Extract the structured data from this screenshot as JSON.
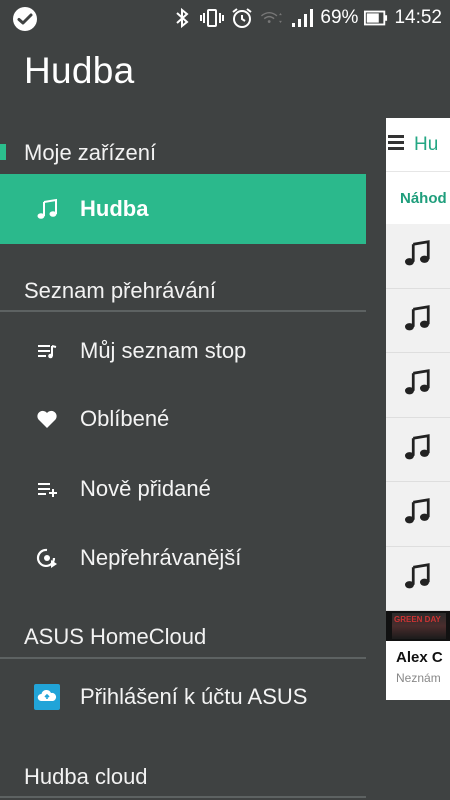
{
  "status_bar": {
    "battery": "69%",
    "time": "14:52",
    "icons": [
      "check-icon",
      "bluetooth-icon",
      "vibrate-icon",
      "alarm-icon",
      "wifi-icon",
      "signal-icon",
      "battery-icon"
    ]
  },
  "drawer": {
    "title": "Hudba",
    "sections": {
      "device": {
        "label": "Moje zařízení",
        "items": [
          {
            "label": "Hudba",
            "icon": "music-note-icon",
            "active": true
          }
        ]
      },
      "playlists": {
        "label": "Seznam přehrávání",
        "items": [
          {
            "label": "Můj seznam stop",
            "icon": "playlist-icon"
          },
          {
            "label": "Oblíbené",
            "icon": "heart-icon"
          },
          {
            "label": "Nově přidané",
            "icon": "playlist-add-icon"
          },
          {
            "label": "Nepřehrávanější",
            "icon": "most-played-icon"
          }
        ]
      },
      "homecloud": {
        "label": "ASUS HomeCloud",
        "items": [
          {
            "label": "Přihlášení k účtu ASUS",
            "icon": "cloud-icon"
          }
        ]
      },
      "cloud": {
        "label": "Hudba cloud"
      }
    }
  },
  "right_panel": {
    "toolbar_title": "Hu",
    "tab_label": "Náhod",
    "song_rows": 6,
    "album_art_text": "GREEN DAY",
    "card_title": "Alex C",
    "card_subtitle": "Neznám"
  },
  "colors": {
    "background": "#3f4242",
    "accent": "#2bb98c",
    "accent_text": "#24a784"
  }
}
